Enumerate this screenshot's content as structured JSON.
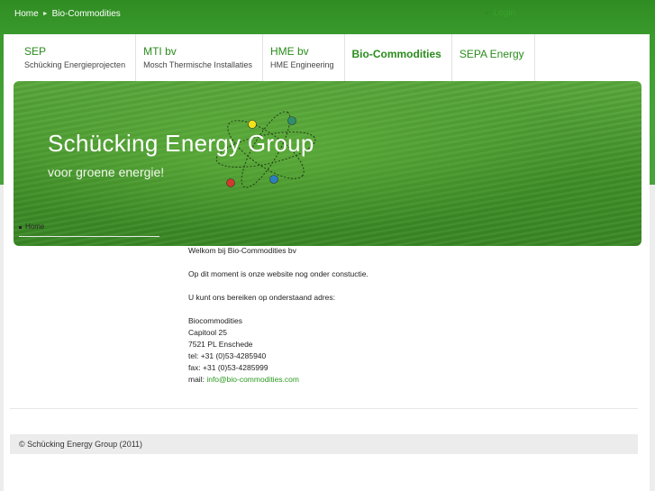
{
  "breadcrumb": {
    "home": "Home",
    "current": "Bio-Commodities"
  },
  "login": {
    "label": "Login"
  },
  "nav": [
    {
      "title": "SEP",
      "sub": "Schücking Energieprojecten"
    },
    {
      "title": "MTI bv",
      "sub": "Mosch Thermische Installaties"
    },
    {
      "title": "HME bv",
      "sub": "HME Engineering"
    },
    {
      "title": "Bio-Commodities",
      "sub": ""
    },
    {
      "title": "SEPA Energy",
      "sub": ""
    }
  ],
  "banner": {
    "title": "Schücking Energy Group",
    "subtitle": "voor groene energie!"
  },
  "side_menu": [
    {
      "label": "Home"
    }
  ],
  "content": {
    "welcome": "Welkom bij Bio-Commodities bv",
    "construction": "Op dit moment is onze website nog onder constuctie.",
    "reach": "U kunt ons bereiken op onderstaand adres:",
    "company": "Biocommodities",
    "street": "Capitool 25",
    "city": "7521 PL Enschede",
    "tel": "tel: +31 (0)53-4285940",
    "fax": "fax: +31 (0)53-4285999",
    "mail_label": "mail:",
    "mail": "info@bio-commodities.com"
  },
  "footer": {
    "copyright": "© Schücking Energy Group (2011)"
  },
  "colors": {
    "brand_green": "#2a8c1c",
    "header_green": "#3a9a2c",
    "link_green": "#2a9a1e"
  },
  "icons": {
    "breadcrumb_separator": "chevron-right-icon",
    "login": "arrow-right-icon",
    "logo": "atom-logo-icon"
  }
}
